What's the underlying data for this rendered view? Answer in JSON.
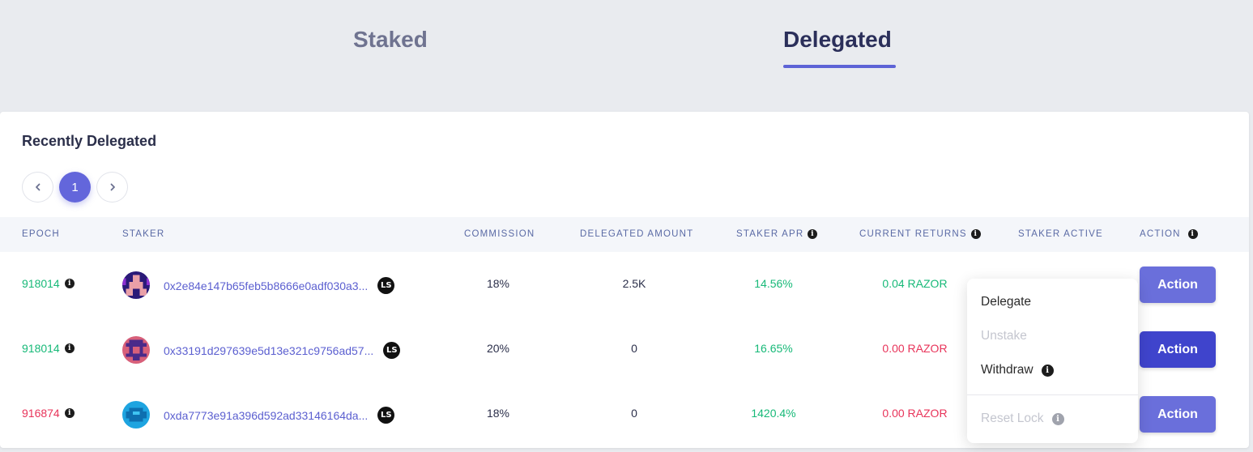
{
  "tabs": [
    {
      "label": "Staked",
      "active": false
    },
    {
      "label": "Delegated",
      "active": true
    }
  ],
  "section_title": "Recently Delegated",
  "pagination": {
    "prev_icon": "chevron-left-icon",
    "current_page": "1",
    "next_icon": "chevron-right-icon"
  },
  "columns": {
    "epoch": "EPOCH",
    "staker": "STAKER",
    "commission": "COMMISSION",
    "delegated_amount": "DELEGATED AMOUNT",
    "staker_apr": "STAKER APR",
    "current_returns": "CURRENT RETURNS",
    "staker_active": "STAKER ACTIVE",
    "action": "ACTION"
  },
  "rows": [
    {
      "epoch": "918014",
      "epoch_status": "green",
      "staker": "0x2e84e147b65feb5b8666e0adf030a3...",
      "badge": "LS",
      "commission": "18%",
      "delegated_amount": "2.5K",
      "staker_apr": "14.56%",
      "current_returns": "0.04 RAZOR",
      "returns_status": "green",
      "action_label": "Action"
    },
    {
      "epoch": "918014",
      "epoch_status": "green",
      "staker": "0x33191d297639e5d13e321c9756ad57...",
      "badge": "LS",
      "commission": "20%",
      "delegated_amount": "0",
      "staker_apr": "16.65%",
      "current_returns": "0.00 RAZOR",
      "returns_status": "red",
      "action_label": "Action"
    },
    {
      "epoch": "916874",
      "epoch_status": "red",
      "staker": "0xda7773e91a396d592ad33146164da...",
      "badge": "LS",
      "commission": "18%",
      "delegated_amount": "0",
      "staker_apr": "1420.4%",
      "current_returns": "0.00 RAZOR",
      "returns_status": "red",
      "action_label": "Action"
    }
  ],
  "dropdown": {
    "items": [
      {
        "label": "Delegate",
        "enabled": true
      },
      {
        "label": "Unstake",
        "enabled": false
      },
      {
        "label": "Withdraw",
        "enabled": true
      },
      {
        "label": "Reset Lock",
        "enabled": false
      }
    ]
  },
  "colors": {
    "accent": "#6366db",
    "positive": "#17b978",
    "negative": "#e8345a"
  }
}
